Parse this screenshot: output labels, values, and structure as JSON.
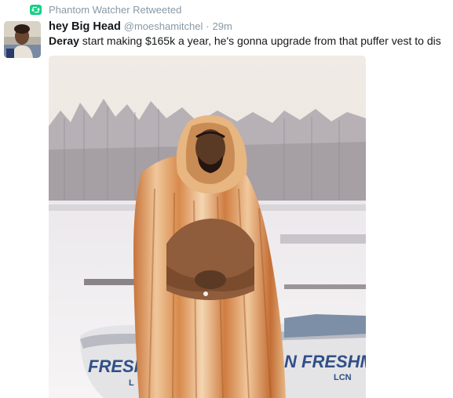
{
  "retweet": {
    "icon": "retweet-icon",
    "text": "Phantom Watcher Retweeted"
  },
  "author": {
    "name": "hey Big Head",
    "handle": "@moeshamitchel",
    "separator": "·",
    "time": "29m"
  },
  "tweet": {
    "mention": "Deray",
    "body": " start making $165k a year, he's gonna upgrade from that puffer vest to dis"
  },
  "media": {
    "boat_text_left": "FRESHM",
    "boat_text_right": "N FRESHMEN",
    "boat_sub_left": "L",
    "boat_sub_right": "LCN"
  },
  "colors": {
    "retweet_green": "#19cf86",
    "meta_gray": "#8899a6",
    "text_dark": "#14171a"
  }
}
